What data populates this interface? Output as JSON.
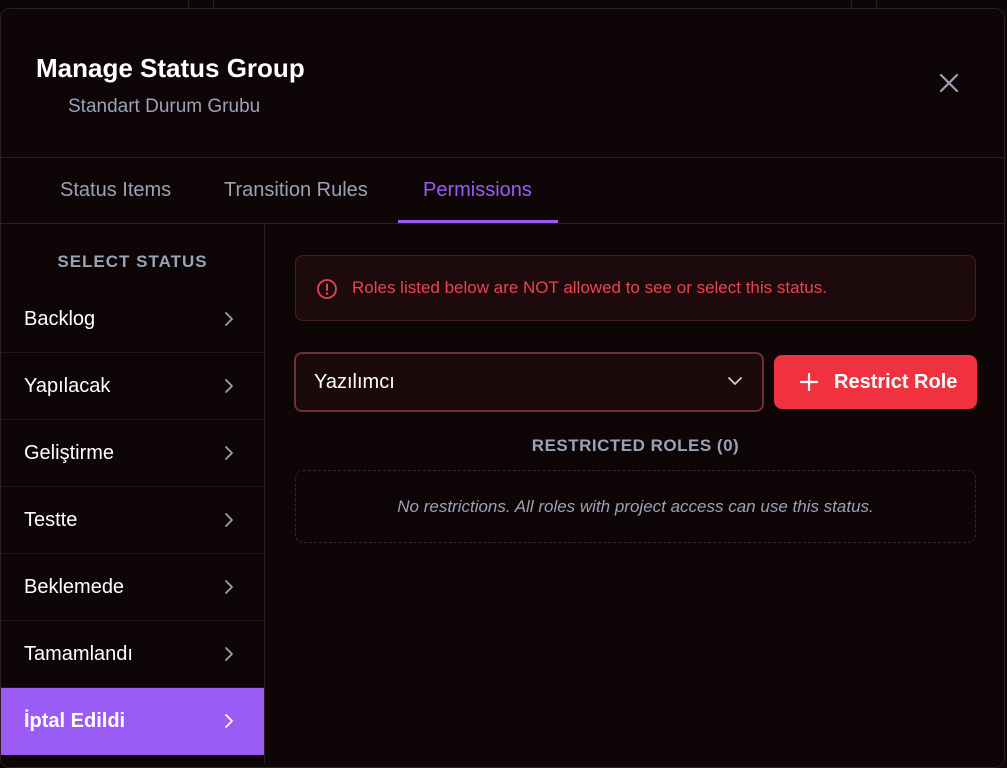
{
  "modal": {
    "title": "Manage Status Group",
    "subtitle": "Standart Durum Grubu"
  },
  "tabs": [
    {
      "label": "Status Items",
      "active": false
    },
    {
      "label": "Transition Rules",
      "active": false
    },
    {
      "label": "Permissions",
      "active": true
    }
  ],
  "sidebar": {
    "heading": "SELECT STATUS",
    "items": [
      {
        "label": "Backlog",
        "selected": false
      },
      {
        "label": "Yapılacak",
        "selected": false
      },
      {
        "label": "Geliştirme",
        "selected": false
      },
      {
        "label": "Testte",
        "selected": false
      },
      {
        "label": "Beklemede",
        "selected": false
      },
      {
        "label": "Tamamlandı",
        "selected": false
      },
      {
        "label": "İptal Edildi",
        "selected": true
      }
    ]
  },
  "permissions": {
    "alert_text": "Roles listed below are NOT allowed to see or select this status.",
    "role_select_value": "Yazılımcı",
    "restrict_button_label": "Restrict Role",
    "restricted_heading": "RESTRICTED ROLES (0)",
    "empty_text": "No restrictions. All roles with project access can use this status."
  },
  "colors": {
    "accent": "#9b5cf6",
    "danger": "#f0313f",
    "alert_text": "#ea4452",
    "background": "#0d0506"
  },
  "icons": {
    "close": "close-icon",
    "chevron": "chevron-right-icon",
    "alert": "info-circle-icon",
    "select": "chevron-down-icon",
    "add": "plus-icon"
  }
}
